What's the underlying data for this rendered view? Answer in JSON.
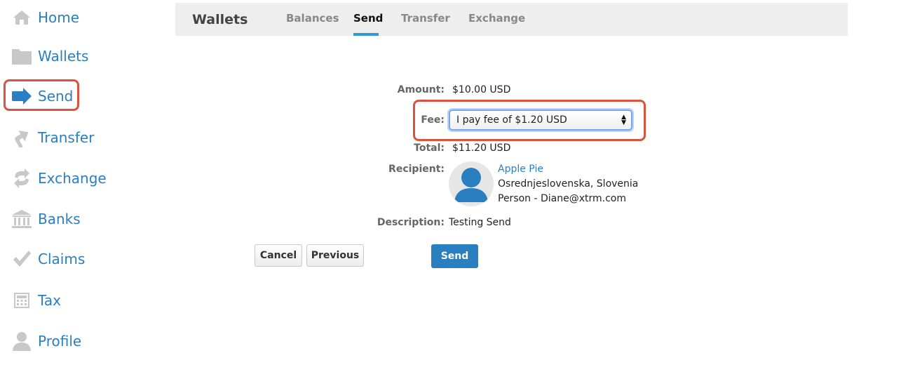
{
  "sidebar": {
    "items": [
      {
        "label": "Home",
        "icon": "home-icon"
      },
      {
        "label": "Wallets",
        "icon": "folder-icon"
      },
      {
        "label": "Send",
        "icon": "arrow-right-icon"
      },
      {
        "label": "Transfer",
        "icon": "arrow-up-right-icon"
      },
      {
        "label": "Exchange",
        "icon": "exchange-icon"
      },
      {
        "label": "Banks",
        "icon": "bank-icon"
      },
      {
        "label": "Claims",
        "icon": "checkmark-icon"
      },
      {
        "label": "Tax",
        "icon": "calculator-icon"
      },
      {
        "label": "Profile",
        "icon": "person-icon"
      }
    ],
    "active": "Send"
  },
  "header": {
    "title": "Wallets",
    "tabs": [
      {
        "label": "Balances"
      },
      {
        "label": "Send"
      },
      {
        "label": "Transfer"
      },
      {
        "label": "Exchange"
      }
    ],
    "active_tab": "Send"
  },
  "form": {
    "amount_label": "Amount:",
    "amount_value": "$10.00 USD",
    "fee_label": "Fee:",
    "fee_selected": "I pay fee of $1.20 USD",
    "total_label": "Total:",
    "total_value": "$11.20 USD",
    "recipient_label": "Recipient:",
    "recipient": {
      "name": "Apple Pie",
      "location": "Osrednjeslovenska, Slovenia",
      "details": "Person - Diane@xtrm.com"
    },
    "description_label": "Description:",
    "description_value": "Testing Send"
  },
  "buttons": {
    "cancel": "Cancel",
    "previous": "Previous",
    "send": "Send"
  },
  "colors": {
    "accent": "#2a7fc1",
    "highlight": "#d9533f",
    "tab_underline": "#2a9bd6"
  }
}
